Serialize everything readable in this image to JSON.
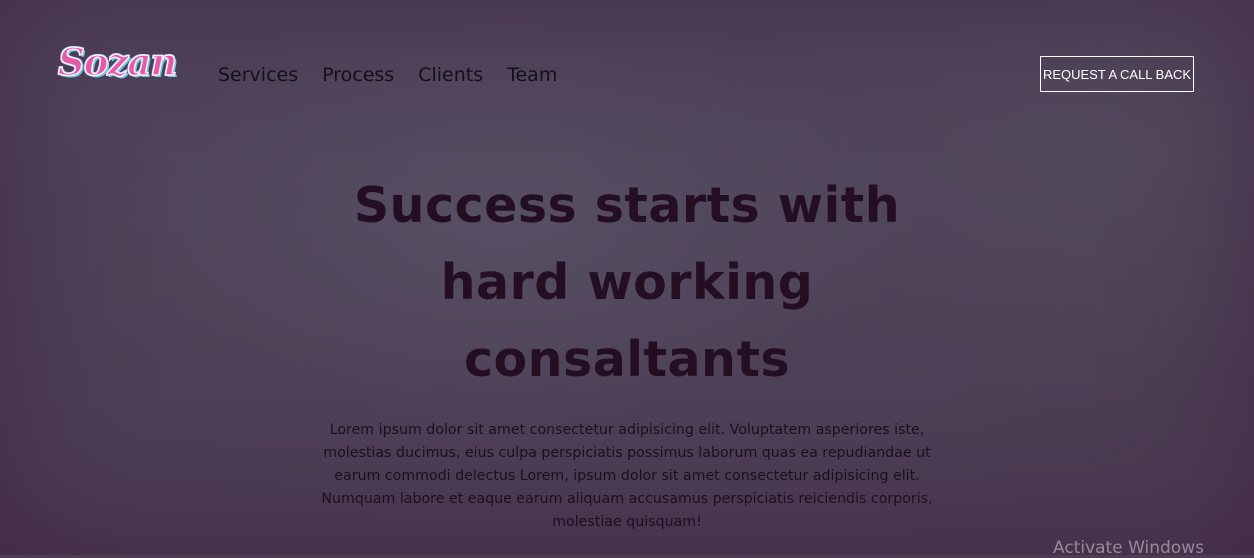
{
  "brand": {
    "logo_text": "Sozan"
  },
  "nav": {
    "items": [
      {
        "label": "Services"
      },
      {
        "label": "Process"
      },
      {
        "label": "Clients"
      },
      {
        "label": "Team"
      }
    ]
  },
  "header": {
    "cta_label": "REQUEST A CALL BACK"
  },
  "hero": {
    "title_lines": [
      "Success starts with",
      "hard working",
      "consaltants"
    ],
    "description": "Lorem ipsum dolor sit amet consectetur adipisicing elit. Voluptatem asperiores iste, molestias ducimus, eius culpa perspiciatis possimus laborum quas ea repudiandae ut earum commodi delectus Lorem, ipsum dolor sit amet consectetur adipisicing elit. Numquam labore et eaque earum aliquam accusamus perspiciatis reiciendis corporis, molestiae quisquam!"
  },
  "system": {
    "watermark": "Activate Windows"
  },
  "colors": {
    "logo_pink": "#e35aa7",
    "logo_outline_blue": "#69c9e8",
    "title_text": "#230e22",
    "background": "#4d3d52",
    "cta_border": "#ffffff"
  }
}
